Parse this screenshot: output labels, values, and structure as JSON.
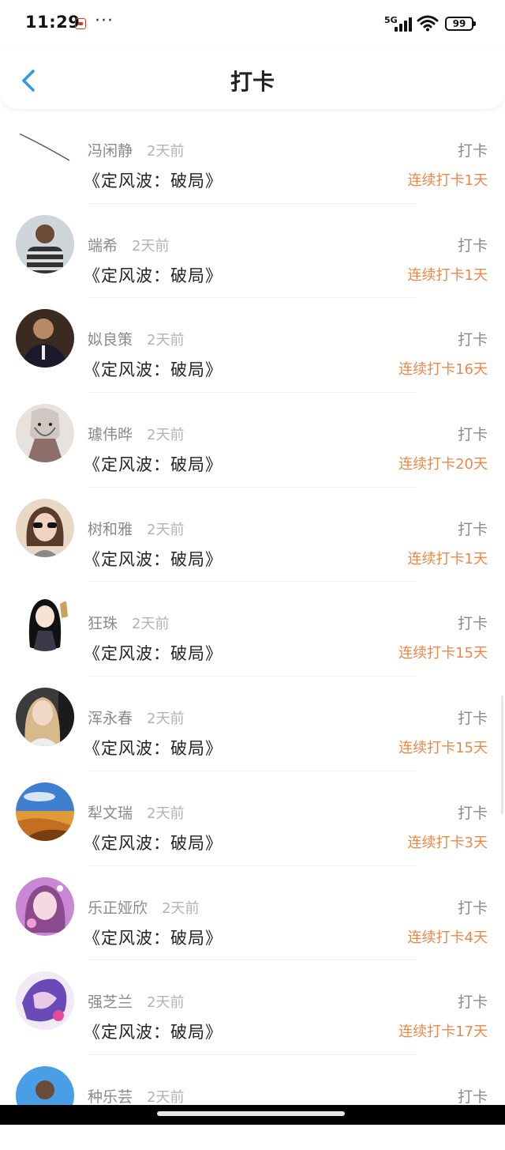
{
  "status": {
    "time": "11:29",
    "network": "5G",
    "battery": "99"
  },
  "nav": {
    "title": "打卡"
  },
  "colors": {
    "accent": "#2b9be6",
    "streak": "#e8894a"
  },
  "items": [
    {
      "name": "冯闲静",
      "time": "2天前",
      "book": "《定风波：破局》",
      "action": "打卡",
      "streak": "连续打卡1天",
      "avatar": "sketch-line"
    },
    {
      "name": "端希",
      "time": "2天前",
      "book": "《定风波：破局》",
      "action": "打卡",
      "streak": "连续打卡1天",
      "avatar": "striped-shirt-person"
    },
    {
      "name": "姒良策",
      "time": "2天前",
      "book": "《定风波：破局》",
      "action": "打卡",
      "streak": "连续打卡16天",
      "avatar": "suited-man"
    },
    {
      "name": "璩伟晔",
      "time": "2天前",
      "book": "《定风波：破局》",
      "action": "打卡",
      "streak": "连续打卡20天",
      "avatar": "anime-sketch"
    },
    {
      "name": "树和雅",
      "time": "2天前",
      "book": "《定风波：破局》",
      "action": "打卡",
      "streak": "连续打卡1天",
      "avatar": "woman-sunglasses"
    },
    {
      "name": "狂珠",
      "time": "2天前",
      "book": "《定风波：破局》",
      "action": "打卡",
      "streak": "连续打卡15天",
      "avatar": "anime-girl-guitar"
    },
    {
      "name": "浑永春",
      "time": "2天前",
      "book": "《定风波：破局》",
      "action": "打卡",
      "streak": "连续打卡15天",
      "avatar": "blonde-woman"
    },
    {
      "name": "犁文瑞",
      "time": "2天前",
      "book": "《定风波：破局》",
      "action": "打卡",
      "streak": "连续打卡3天",
      "avatar": "desert-landscape"
    },
    {
      "name": "乐正娅欣",
      "time": "2天前",
      "book": "《定风波：破局》",
      "action": "打卡",
      "streak": "连续打卡4天",
      "avatar": "girl-filter"
    },
    {
      "name": "强芝兰",
      "time": "2天前",
      "book": "《定风波：破局》",
      "action": "打卡",
      "streak": "连续打卡17天",
      "avatar": "anime-purple"
    },
    {
      "name": "种乐芸",
      "time": "2天前",
      "book": "",
      "action": "打卡",
      "streak": "",
      "avatar": "person-sky"
    }
  ]
}
